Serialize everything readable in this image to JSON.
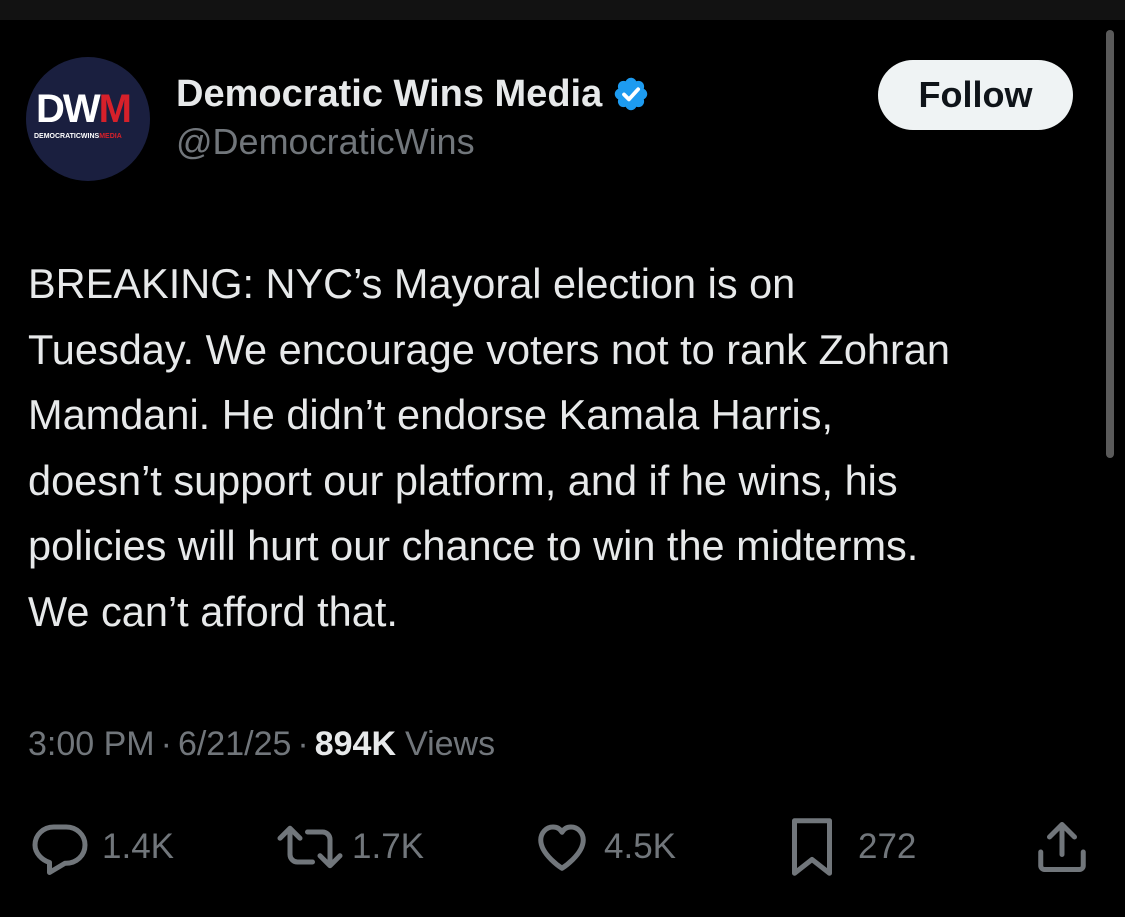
{
  "avatar": {
    "initials_main": "DW",
    "initials_accent": "M",
    "subtitle_main": "DEMOCRATICWINS",
    "subtitle_accent": "MEDIA"
  },
  "author": {
    "display_name": "Democratic Wins Media",
    "handle": "@DemocraticWins",
    "verified": true
  },
  "follow_label": "Follow",
  "tweet": {
    "lines": [
      "BREAKING: NYC’s Mayoral election is on",
      "Tuesday. We encourage voters not to rank Zohran",
      "Mamdani. He didn’t endorse Kamala Harris,",
      "doesn’t support our platform, and if he wins, his",
      "policies will hurt our chance to win the midterms.",
      "We can’t afford that."
    ]
  },
  "meta": {
    "time": "3:00 PM",
    "date": "6/21/25",
    "separator": "·",
    "views_count": "894K",
    "views_label": "Views"
  },
  "actions": {
    "replies": "1.4K",
    "reposts": "1.7K",
    "likes": "4.5K",
    "bookmarks": "272"
  },
  "colors": {
    "background": "#000000",
    "text_primary": "#e7e9ea",
    "text_secondary": "#71767b",
    "verified_blue": "#1d9bf0",
    "follow_button_bg": "#eff3f4",
    "brand_red": "#d6202a"
  }
}
